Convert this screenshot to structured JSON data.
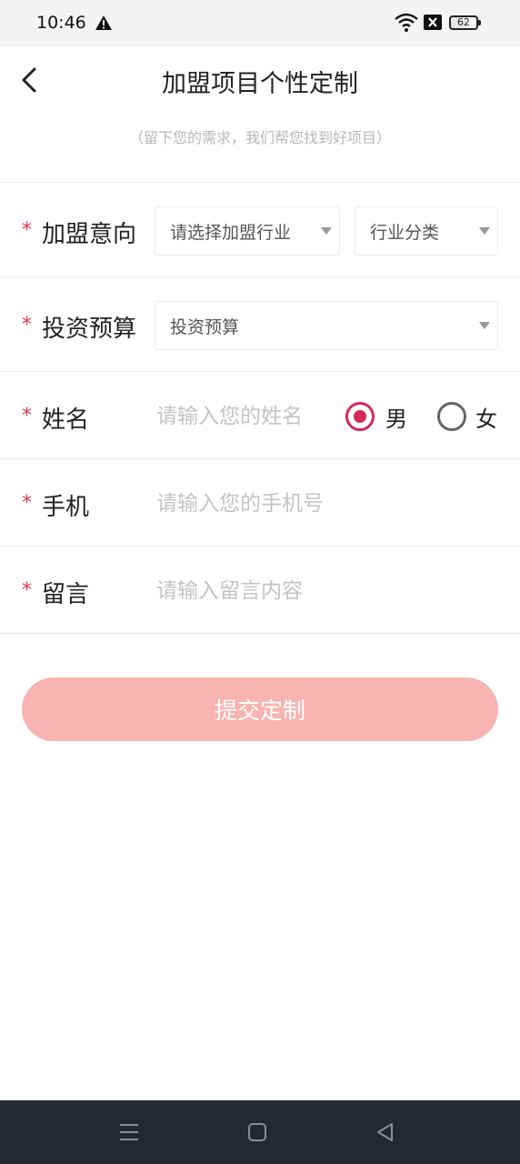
{
  "status_bar": {
    "time": "10:46",
    "battery": "62",
    "icons": [
      "warning-icon",
      "wifi-icon",
      "sim-off-icon",
      "battery-icon"
    ]
  },
  "header": {
    "title": "加盟项目个性定制",
    "subtitle": "（留下您的需求，我们帮您找到好项目）"
  },
  "form": {
    "required_mark": "*",
    "intent": {
      "label": "加盟意向",
      "industry_select": "请选择加盟行业",
      "category_select": "行业分类"
    },
    "budget": {
      "label": "投资预算",
      "select": "投资预算"
    },
    "name": {
      "label": "姓名",
      "placeholder": "请输入您的姓名",
      "gender_male": "男",
      "gender_female": "女",
      "selected_gender": "男"
    },
    "phone": {
      "label": "手机",
      "placeholder": "请输入您的手机号"
    },
    "message": {
      "label": "留言",
      "placeholder": "请输入留言内容"
    },
    "submit_label": "提交定制"
  },
  "colors": {
    "accent": "#d6295a",
    "required": "#e0364a",
    "submit_bg": "#f8b4b0",
    "nav_bar_bg": "#242833"
  }
}
